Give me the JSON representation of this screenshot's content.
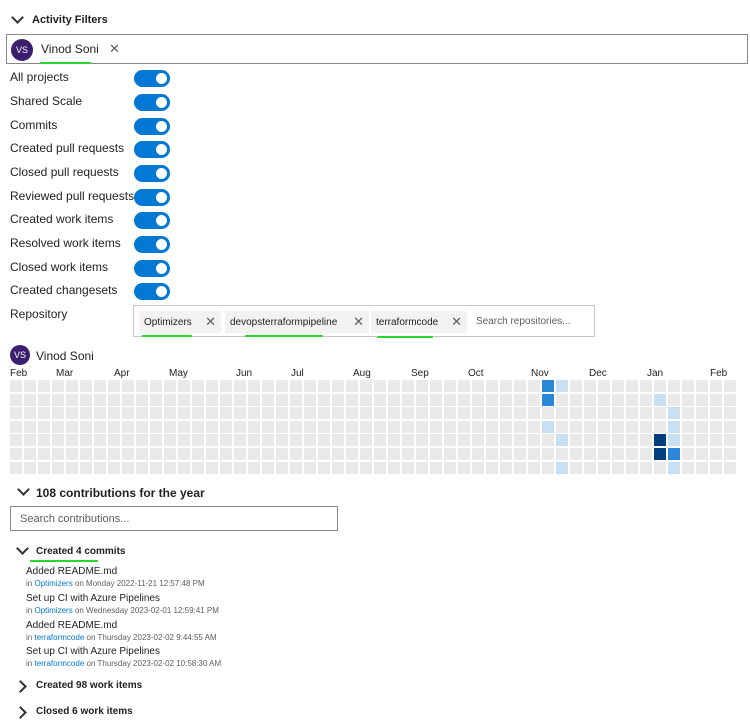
{
  "activity_filters": {
    "title": "Activity Filters",
    "person": {
      "initials": "VS",
      "name": "Vinod Soni"
    }
  },
  "toggles": [
    {
      "label": "All projects",
      "on": true
    },
    {
      "label": "Shared Scale",
      "on": true
    },
    {
      "label": "Commits",
      "on": true
    },
    {
      "label": "Created pull requests",
      "on": true
    },
    {
      "label": "Closed pull requests",
      "on": true
    },
    {
      "label": "Reviewed pull requests",
      "on": true
    },
    {
      "label": "Created work items",
      "on": true
    },
    {
      "label": "Resolved work items",
      "on": true
    },
    {
      "label": "Closed work items",
      "on": true
    },
    {
      "label": "Created changesets",
      "on": true
    }
  ],
  "repository": {
    "label": "Repository",
    "chips": [
      "Optimizers",
      "devopsterraformpipeline",
      "terraformcode"
    ],
    "search_placeholder": "Search repositories..."
  },
  "contributions": {
    "person": {
      "initials": "VS",
      "name": "Vinod Soni"
    },
    "months": [
      "Feb",
      "Mar",
      "Apr",
      "May",
      "Jun",
      "Jul",
      "Aug",
      "Sep",
      "Oct",
      "Nov",
      "Dec",
      "Jan",
      "Feb"
    ],
    "activity": [
      {
        "week": 38,
        "day": 0,
        "level": 3
      },
      {
        "week": 38,
        "day": 1,
        "level": 3
      },
      {
        "week": 39,
        "day": 0,
        "level": 1
      },
      {
        "week": 38,
        "day": 3,
        "level": 1
      },
      {
        "week": 39,
        "day": 4,
        "level": 1
      },
      {
        "week": 39,
        "day": 6,
        "level": 1
      },
      {
        "week": 46,
        "day": 1,
        "level": 1
      },
      {
        "week": 47,
        "day": 2,
        "level": 1
      },
      {
        "week": 46,
        "day": 4,
        "level": 4
      },
      {
        "week": 46,
        "day": 5,
        "level": 4
      },
      {
        "week": 47,
        "day": 3,
        "level": 1
      },
      {
        "week": 47,
        "day": 4,
        "level": 1
      },
      {
        "week": 47,
        "day": 5,
        "level": 3
      },
      {
        "week": 47,
        "day": 6,
        "level": 1
      }
    ],
    "level_colors": [
      "#eaeaea",
      "#c7e0f4",
      "#71afe5",
      "#2b88d8",
      "#003f7f"
    ],
    "summary": "108 contributions for the year",
    "search_placeholder": "Search contributions..."
  },
  "commits_group": {
    "title": "Created 4 commits",
    "items": [
      {
        "title": "Added README.md",
        "prefix": "in",
        "repo": "Optimizers",
        "when": "on Monday 2022-11-21 12:57:48 PM"
      },
      {
        "title": "Set up CI with Azure Pipelines",
        "prefix": "in",
        "repo": "Optimizers",
        "when": "on Wednesday 2023-02-01 12:59:41 PM"
      },
      {
        "title": "Added README.md",
        "prefix": "in",
        "repo": "terraformcode",
        "when": "on Thursday 2023-02-02 9:44:55 AM"
      },
      {
        "title": "Set up CI with Azure Pipelines",
        "prefix": "in",
        "repo": "terraformcode",
        "when": "on Thursday 2023-02-02 10:58:30 AM"
      }
    ]
  },
  "work_items_created": {
    "title": "Created 98 work items"
  },
  "work_items_closed": {
    "title": "Closed 6 work items"
  }
}
